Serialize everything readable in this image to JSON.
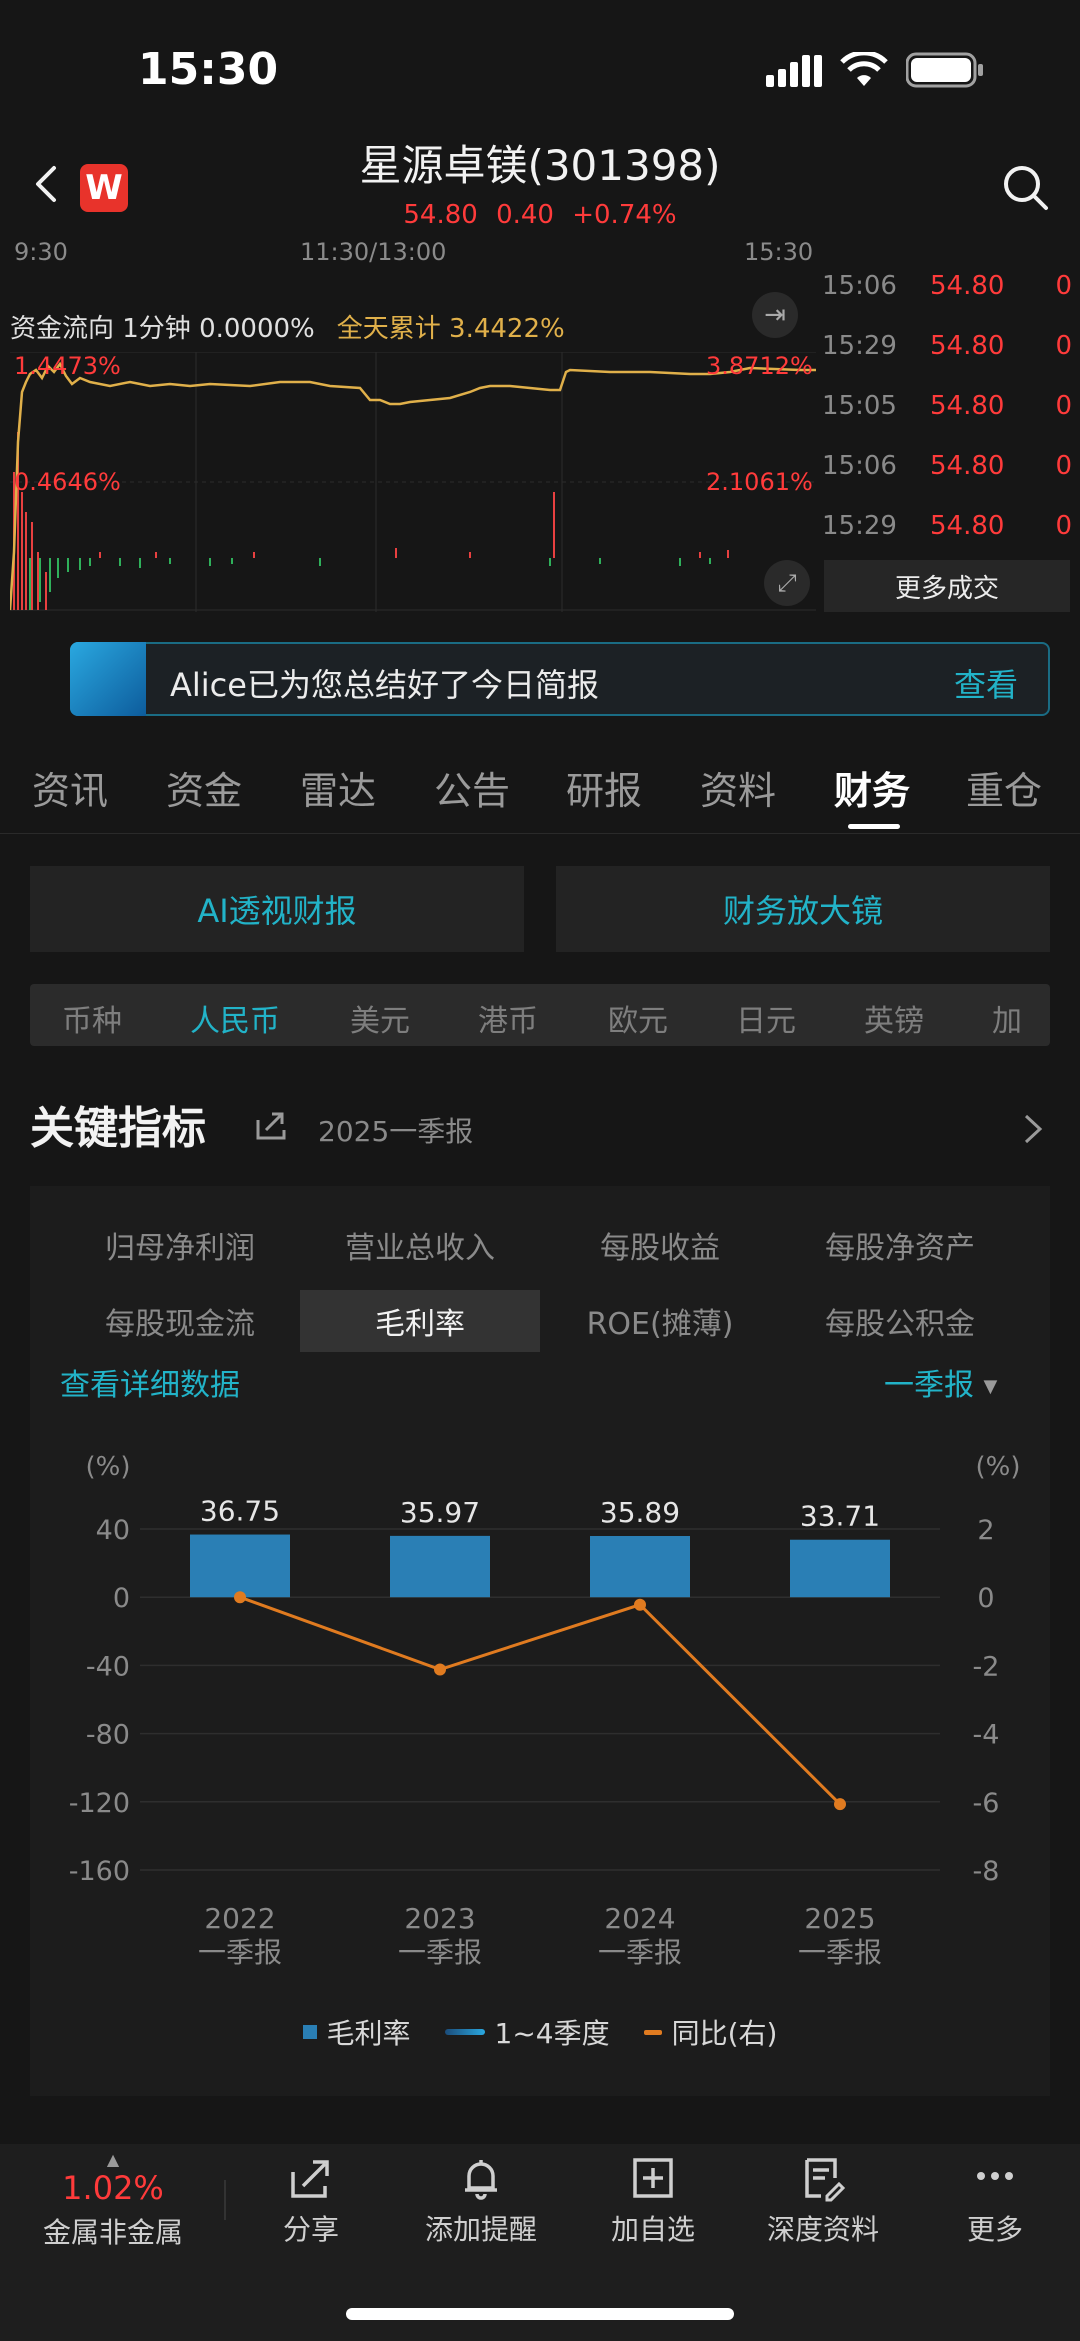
{
  "status": {
    "time": "15:30"
  },
  "header": {
    "title": "星源卓镁(301398)",
    "price": "54.80",
    "change": "0.40",
    "change_pct": "+0.74%",
    "logo_letter": "W"
  },
  "intraday": {
    "times": [
      "9:30",
      "11:30/13:00",
      "15:30"
    ],
    "flow_label": "资金流向 1分钟 0.0000%",
    "accum_label": "全天累计 3.4422%",
    "left_top": "1.4473%",
    "left_mid": "0.4646%",
    "right_top": "3.8712%",
    "right_mid": "2.1061%"
  },
  "trades": [
    {
      "time": "15:06",
      "price": "54.80",
      "vol": "0"
    },
    {
      "time": "15:29",
      "price": "54.80",
      "vol": "0"
    },
    {
      "time": "15:05",
      "price": "54.80",
      "vol": "0"
    },
    {
      "time": "15:06",
      "price": "54.80",
      "vol": "0"
    },
    {
      "time": "15:29",
      "price": "54.80",
      "vol": "0"
    }
  ],
  "more_trades": "更多成交",
  "banner": {
    "text": "Alice已为您总结好了今日简报",
    "action": "查看"
  },
  "tabs": [
    "资讯",
    "资金",
    "雷达",
    "公告",
    "研报",
    "资料",
    "财务",
    "重仓"
  ],
  "active_tab": "财务",
  "buttons": {
    "ai_report": "AI透视财报",
    "magnifier": "财务放大镜"
  },
  "currencies": [
    "币种",
    "人民币",
    "美元",
    "港币",
    "欧元",
    "日元",
    "英镑",
    "加元"
  ],
  "active_currency": "人民币",
  "section": {
    "title": "关键指标",
    "period": "2025一季报"
  },
  "metrics": [
    "归母净利润",
    "营业总收入",
    "每股收益",
    "每股净资产",
    "每股现金流",
    "毛利率",
    "ROE(摊薄)",
    "每股公积金"
  ],
  "active_metric": "毛利率",
  "detail_link": "查看详细数据",
  "quarter_select": "一季报",
  "chart_data": {
    "type": "bar",
    "categories": [
      "2022\n一季报",
      "2023\n一季报",
      "2024\n一季报",
      "2025\n一季报"
    ],
    "category_years": [
      "2022",
      "2023",
      "2024",
      "2025"
    ],
    "category_sub": [
      "一季报",
      "一季报",
      "一季报",
      "一季报"
    ],
    "series": [
      {
        "name": "毛利率",
        "axis": "left",
        "type": "bar",
        "values": [
          36.75,
          35.97,
          35.89,
          33.71
        ],
        "color": "#2a7fb5"
      },
      {
        "name": "同比(右)",
        "axis": "right",
        "type": "line",
        "values": [
          0,
          -2.12,
          -0.22,
          -6.07
        ],
        "color": "#e07b20"
      }
    ],
    "legend": [
      "毛利率",
      "1~4季度",
      "同比(右)"
    ],
    "left_unit": "(%)",
    "right_unit": "(%)",
    "left_ticks": [
      40,
      0,
      -40,
      -80,
      -120,
      -160
    ],
    "right_ticks": [
      2,
      0,
      -2,
      -4,
      -6,
      -8
    ],
    "ylim_left": [
      -160,
      40
    ],
    "ylim_right": [
      -8,
      2
    ]
  },
  "bottom": {
    "index_change": "1.02%",
    "index_name": "金属非金属",
    "items": [
      "分享",
      "添加提醒",
      "加自选",
      "深度资料",
      "更多"
    ]
  }
}
